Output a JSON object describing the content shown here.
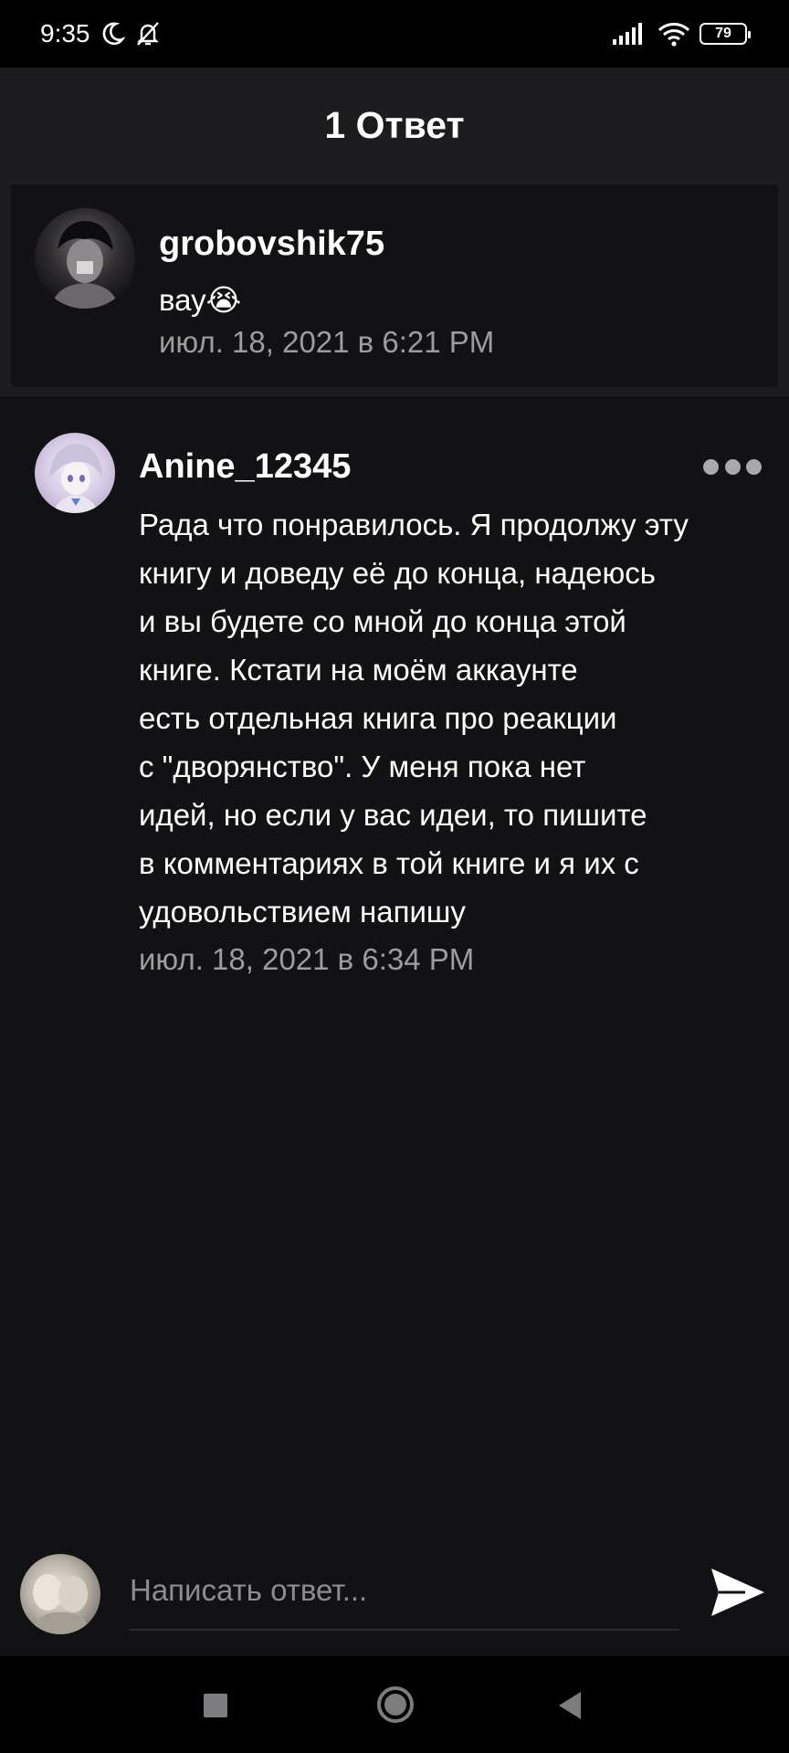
{
  "status_bar": {
    "time": "9:35",
    "icons": [
      "moon-icon",
      "bell-off-icon",
      "signal-icon",
      "wifi-icon"
    ],
    "battery": "79"
  },
  "header": {
    "title": "1 Ответ"
  },
  "parent_comment": {
    "username": "grobovshik75",
    "text": "вау😭",
    "timestamp": "июл. 18, 2021 в 6:21 PM"
  },
  "reply": {
    "username": "Anine_12345",
    "text_lines": [
      "Рада что понравилось. Я продолжу эту",
      "книгу и доведу её до конца, надеюсь",
      "и вы будете со мной до конца этой",
      "книге. Кстати на моём аккаунте",
      "есть отдельная книга про реакции",
      "с \"дворянство\". У меня пока нет",
      "идей, но если у вас идеи, то пишите",
      "в комментариях в той книге и я их с",
      "удовольствием напишу"
    ],
    "timestamp": "июл. 18, 2021 в 6:34 PM"
  },
  "reply_box": {
    "placeholder": "Написать ответ...",
    "value": ""
  },
  "nav_bar": {
    "buttons": [
      "recents-icon",
      "home-icon",
      "back-icon"
    ]
  },
  "colors": {
    "background": "#121113",
    "header": "#1d1c1e",
    "muted_text": "#9d9c9e",
    "status_bar": "#000000"
  }
}
